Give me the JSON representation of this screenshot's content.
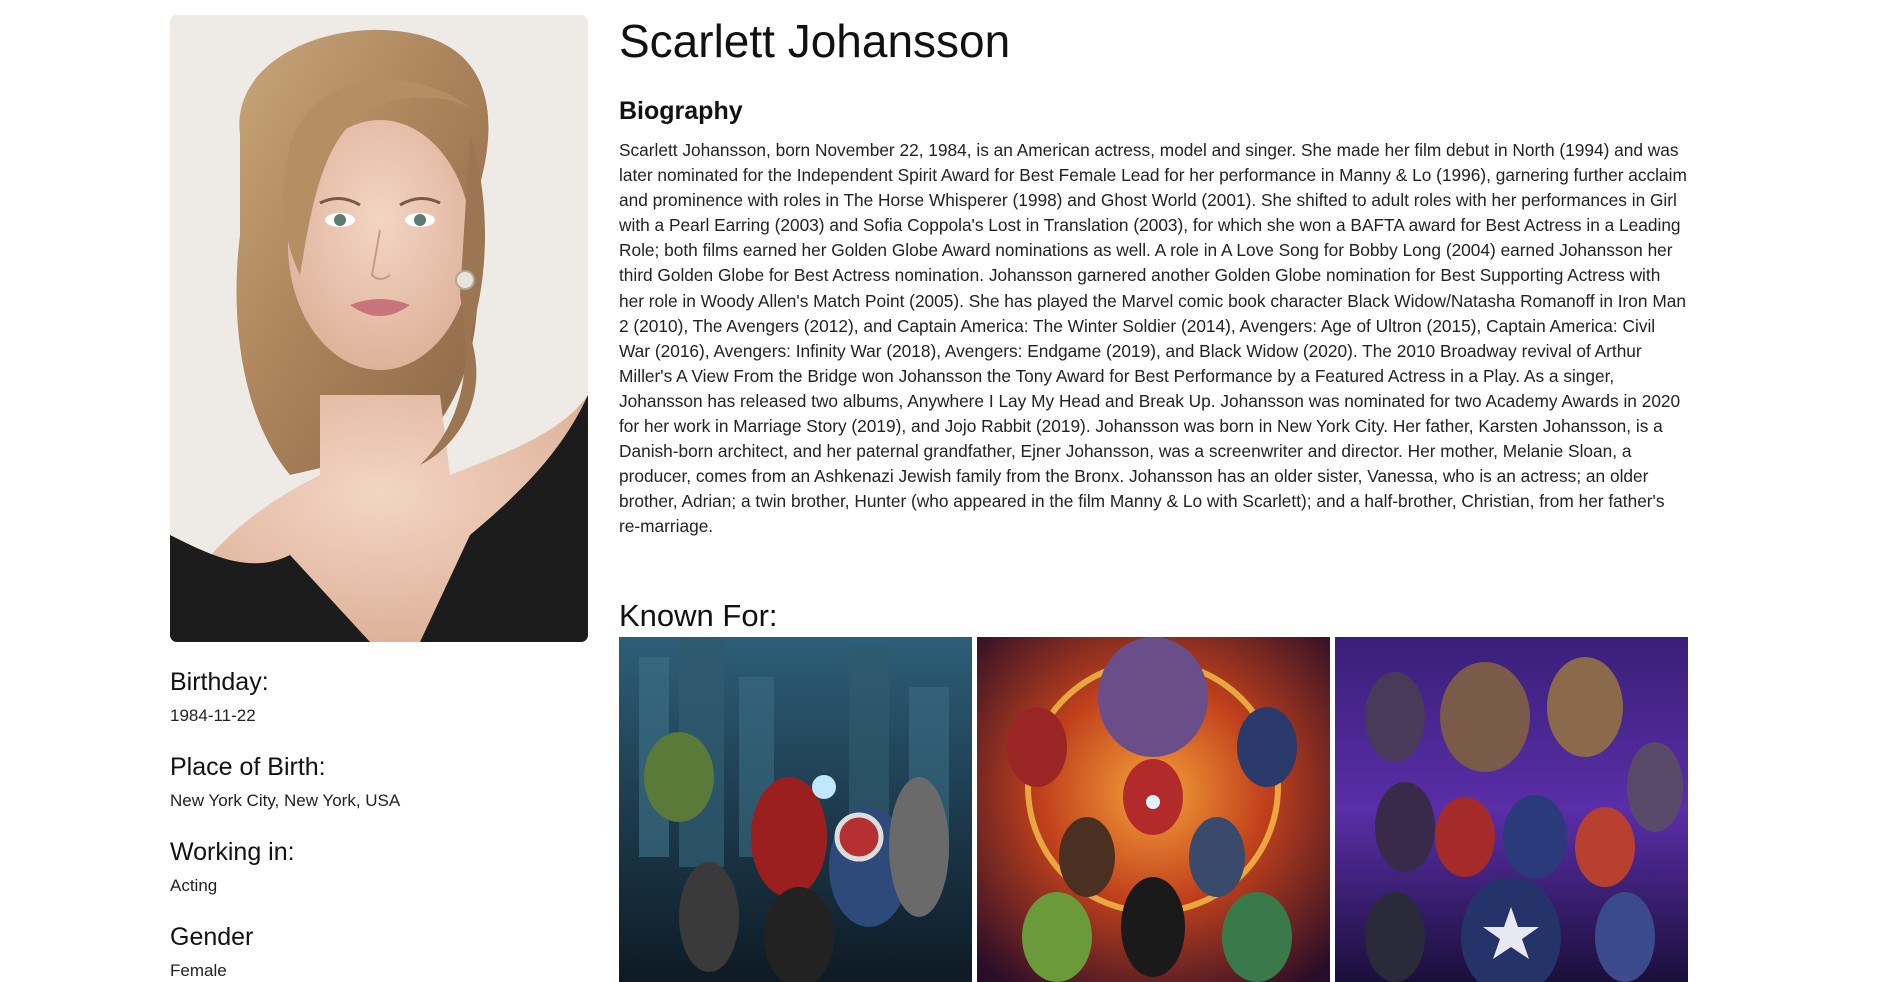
{
  "person": {
    "name": "Scarlett Johansson",
    "biography_heading": "Biography",
    "biography": "Scarlett Johansson, born November 22, 1984, is an American actress, model and singer. She made her film debut in North (1994) and was later nominated for the Independent Spirit Award for Best Female Lead for her performance in Manny & Lo (1996), garnering further acclaim and prominence with roles in The Horse Whisperer (1998) and Ghost World (2001). She shifted to adult roles with her performances in Girl with a Pearl Earring (2003) and Sofia Coppola's Lost in Translation (2003), for which she won a BAFTA award for Best Actress in a Leading Role; both films earned her Golden Globe Award nominations as well. A role in A Love Song for Bobby Long (2004) earned Johansson her third Golden Globe for Best Actress nomination. Johansson garnered another Golden Globe nomination for Best Supporting Actress with her role in Woody Allen's Match Point (2005). She has played the Marvel comic book character Black Widow/Natasha Romanoff in Iron Man 2 (2010), The Avengers (2012), and Captain America: The Winter Soldier (2014), Avengers: Age of Ultron (2015), Captain America: Civil War (2016), Avengers: Infinity War (2018), Avengers: Endgame (2019), and Black Widow (2020). The 2010 Broadway revival of Arthur Miller's A View From the Bridge won Johansson the Tony Award for Best Performance by a Featured Actress in a Play. As a singer, Johansson has released two albums, Anywhere I Lay My Head and Break Up. Johansson was nominated for two Academy Awards in 2020 for her work in Marriage Story (2019), and Jojo Rabbit (2019). Johansson was born in New York City. Her father, Karsten Johansson, is a Danish-born architect, and her paternal grandfather, Ejner Johansson, was a screenwriter and director. Her mother, Melanie Sloan, a producer, comes from an Ashkenazi Jewish family from the Bronx. Johansson has an older sister, Vanessa, who is an actress; an older brother, Adrian; a twin brother, Hunter (who appeared in the film Manny & Lo with Scarlett); and a half-brother, Christian, from her father's re-marriage."
  },
  "details": {
    "birthday_label": "Birthday:",
    "birthday": "1984-11-22",
    "place_of_birth_label": "Place of Birth:",
    "place_of_birth": "New York City, New York, USA",
    "working_in_label": "Working in:",
    "working_in": "Acting",
    "gender_label": "Gender",
    "gender": "Female"
  },
  "known_for": {
    "heading": "Known For:",
    "posters": [
      {
        "icon": "avengers-poster",
        "accent": "#1e4a66"
      },
      {
        "icon": "infinity-war-poster",
        "accent": "#c2411c"
      },
      {
        "icon": "endgame-poster",
        "accent": "#4a2a8c"
      }
    ]
  }
}
